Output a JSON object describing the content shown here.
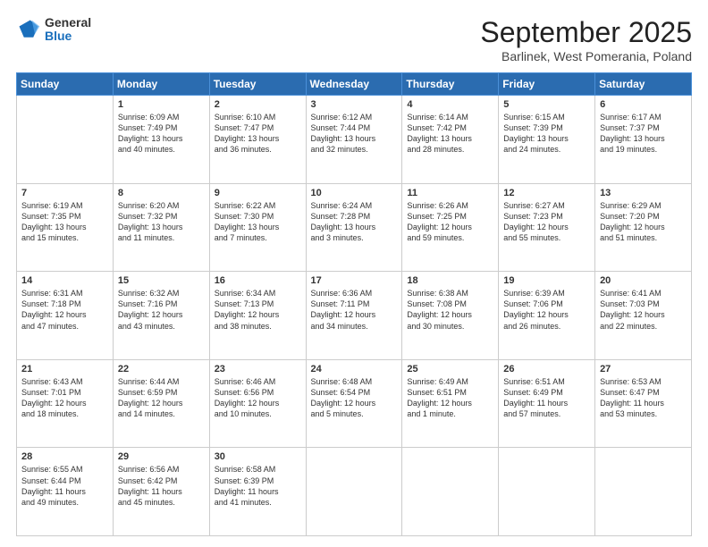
{
  "header": {
    "logo_general": "General",
    "logo_blue": "Blue",
    "month": "September 2025",
    "location": "Barlinek, West Pomerania, Poland"
  },
  "weekdays": [
    "Sunday",
    "Monday",
    "Tuesday",
    "Wednesday",
    "Thursday",
    "Friday",
    "Saturday"
  ],
  "weeks": [
    [
      {
        "day": "",
        "lines": []
      },
      {
        "day": "1",
        "lines": [
          "Sunrise: 6:09 AM",
          "Sunset: 7:49 PM",
          "Daylight: 13 hours",
          "and 40 minutes."
        ]
      },
      {
        "day": "2",
        "lines": [
          "Sunrise: 6:10 AM",
          "Sunset: 7:47 PM",
          "Daylight: 13 hours",
          "and 36 minutes."
        ]
      },
      {
        "day": "3",
        "lines": [
          "Sunrise: 6:12 AM",
          "Sunset: 7:44 PM",
          "Daylight: 13 hours",
          "and 32 minutes."
        ]
      },
      {
        "day": "4",
        "lines": [
          "Sunrise: 6:14 AM",
          "Sunset: 7:42 PM",
          "Daylight: 13 hours",
          "and 28 minutes."
        ]
      },
      {
        "day": "5",
        "lines": [
          "Sunrise: 6:15 AM",
          "Sunset: 7:39 PM",
          "Daylight: 13 hours",
          "and 24 minutes."
        ]
      },
      {
        "day": "6",
        "lines": [
          "Sunrise: 6:17 AM",
          "Sunset: 7:37 PM",
          "Daylight: 13 hours",
          "and 19 minutes."
        ]
      }
    ],
    [
      {
        "day": "7",
        "lines": [
          "Sunrise: 6:19 AM",
          "Sunset: 7:35 PM",
          "Daylight: 13 hours",
          "and 15 minutes."
        ]
      },
      {
        "day": "8",
        "lines": [
          "Sunrise: 6:20 AM",
          "Sunset: 7:32 PM",
          "Daylight: 13 hours",
          "and 11 minutes."
        ]
      },
      {
        "day": "9",
        "lines": [
          "Sunrise: 6:22 AM",
          "Sunset: 7:30 PM",
          "Daylight: 13 hours",
          "and 7 minutes."
        ]
      },
      {
        "day": "10",
        "lines": [
          "Sunrise: 6:24 AM",
          "Sunset: 7:28 PM",
          "Daylight: 13 hours",
          "and 3 minutes."
        ]
      },
      {
        "day": "11",
        "lines": [
          "Sunrise: 6:26 AM",
          "Sunset: 7:25 PM",
          "Daylight: 12 hours",
          "and 59 minutes."
        ]
      },
      {
        "day": "12",
        "lines": [
          "Sunrise: 6:27 AM",
          "Sunset: 7:23 PM",
          "Daylight: 12 hours",
          "and 55 minutes."
        ]
      },
      {
        "day": "13",
        "lines": [
          "Sunrise: 6:29 AM",
          "Sunset: 7:20 PM",
          "Daylight: 12 hours",
          "and 51 minutes."
        ]
      }
    ],
    [
      {
        "day": "14",
        "lines": [
          "Sunrise: 6:31 AM",
          "Sunset: 7:18 PM",
          "Daylight: 12 hours",
          "and 47 minutes."
        ]
      },
      {
        "day": "15",
        "lines": [
          "Sunrise: 6:32 AM",
          "Sunset: 7:16 PM",
          "Daylight: 12 hours",
          "and 43 minutes."
        ]
      },
      {
        "day": "16",
        "lines": [
          "Sunrise: 6:34 AM",
          "Sunset: 7:13 PM",
          "Daylight: 12 hours",
          "and 38 minutes."
        ]
      },
      {
        "day": "17",
        "lines": [
          "Sunrise: 6:36 AM",
          "Sunset: 7:11 PM",
          "Daylight: 12 hours",
          "and 34 minutes."
        ]
      },
      {
        "day": "18",
        "lines": [
          "Sunrise: 6:38 AM",
          "Sunset: 7:08 PM",
          "Daylight: 12 hours",
          "and 30 minutes."
        ]
      },
      {
        "day": "19",
        "lines": [
          "Sunrise: 6:39 AM",
          "Sunset: 7:06 PM",
          "Daylight: 12 hours",
          "and 26 minutes."
        ]
      },
      {
        "day": "20",
        "lines": [
          "Sunrise: 6:41 AM",
          "Sunset: 7:03 PM",
          "Daylight: 12 hours",
          "and 22 minutes."
        ]
      }
    ],
    [
      {
        "day": "21",
        "lines": [
          "Sunrise: 6:43 AM",
          "Sunset: 7:01 PM",
          "Daylight: 12 hours",
          "and 18 minutes."
        ]
      },
      {
        "day": "22",
        "lines": [
          "Sunrise: 6:44 AM",
          "Sunset: 6:59 PM",
          "Daylight: 12 hours",
          "and 14 minutes."
        ]
      },
      {
        "day": "23",
        "lines": [
          "Sunrise: 6:46 AM",
          "Sunset: 6:56 PM",
          "Daylight: 12 hours",
          "and 10 minutes."
        ]
      },
      {
        "day": "24",
        "lines": [
          "Sunrise: 6:48 AM",
          "Sunset: 6:54 PM",
          "Daylight: 12 hours",
          "and 5 minutes."
        ]
      },
      {
        "day": "25",
        "lines": [
          "Sunrise: 6:49 AM",
          "Sunset: 6:51 PM",
          "Daylight: 12 hours",
          "and 1 minute."
        ]
      },
      {
        "day": "26",
        "lines": [
          "Sunrise: 6:51 AM",
          "Sunset: 6:49 PM",
          "Daylight: 11 hours",
          "and 57 minutes."
        ]
      },
      {
        "day": "27",
        "lines": [
          "Sunrise: 6:53 AM",
          "Sunset: 6:47 PM",
          "Daylight: 11 hours",
          "and 53 minutes."
        ]
      }
    ],
    [
      {
        "day": "28",
        "lines": [
          "Sunrise: 6:55 AM",
          "Sunset: 6:44 PM",
          "Daylight: 11 hours",
          "and 49 minutes."
        ]
      },
      {
        "day": "29",
        "lines": [
          "Sunrise: 6:56 AM",
          "Sunset: 6:42 PM",
          "Daylight: 11 hours",
          "and 45 minutes."
        ]
      },
      {
        "day": "30",
        "lines": [
          "Sunrise: 6:58 AM",
          "Sunset: 6:39 PM",
          "Daylight: 11 hours",
          "and 41 minutes."
        ]
      },
      {
        "day": "",
        "lines": []
      },
      {
        "day": "",
        "lines": []
      },
      {
        "day": "",
        "lines": []
      },
      {
        "day": "",
        "lines": []
      }
    ]
  ]
}
